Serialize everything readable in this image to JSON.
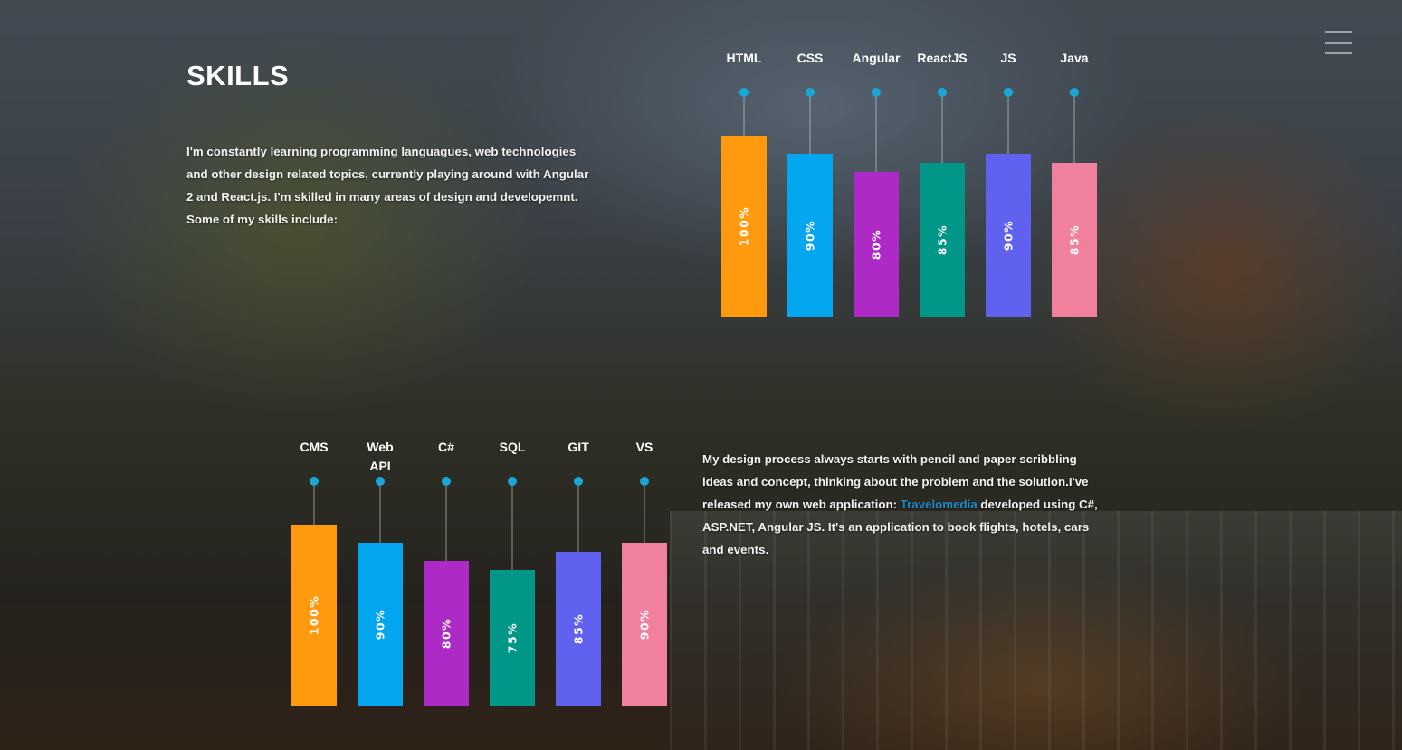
{
  "page": {
    "title": "SKILLS",
    "intro_text": "I'm constantly learning programming languagues, web technologies and other design related topics, currently playing around with Angular 2 and React.js. I'm skilled in many areas of design and developemnt. Some of my skills include:",
    "process": {
      "text_before": "My design process always starts with pencil and paper scribbling ideas and concept, thinking about the problem and the solution.I've released my own web application: ",
      "link_text": "Travelomedia",
      "text_after": " developed using C#, ASP.NET, Angular JS. It's an application to book flights, hotels, cars and events."
    },
    "menu_icon": "hamburger-menu-icon",
    "colors": {
      "orange": "#ff9a0f",
      "blue": "#03a6ef",
      "purple": "#ae2ac6",
      "teal": "#009688",
      "indigo": "#6161ef",
      "pink": "#f0809b",
      "dot": "#19a7d7",
      "link": "#1e88c9"
    }
  },
  "chart_data": [
    {
      "type": "bar",
      "categories": [
        "HTML",
        "CSS",
        "Angular",
        "ReactJS",
        "JS",
        "Java"
      ],
      "values": [
        100,
        90,
        80,
        85,
        90,
        85
      ],
      "value_labels": [
        "100%",
        "90%",
        "80%",
        "85%",
        "90%",
        "85%"
      ],
      "colors": [
        "#ff9a0f",
        "#03a6ef",
        "#ae2ac6",
        "#009688",
        "#6161ef",
        "#f0809b"
      ],
      "ylim": [
        0,
        100
      ],
      "grid": false
    },
    {
      "type": "bar",
      "categories": [
        "CMS",
        "Web API",
        "C#",
        "SQL",
        "GIT",
        "VS"
      ],
      "values": [
        100,
        90,
        80,
        75,
        85,
        90
      ],
      "value_labels": [
        "100%",
        "90%",
        "80%",
        "75%",
        "85%",
        "90%"
      ],
      "colors": [
        "#ff9a0f",
        "#03a6ef",
        "#ae2ac6",
        "#009688",
        "#6161ef",
        "#f0809b"
      ],
      "ylim": [
        0,
        100
      ],
      "grid": false
    }
  ]
}
